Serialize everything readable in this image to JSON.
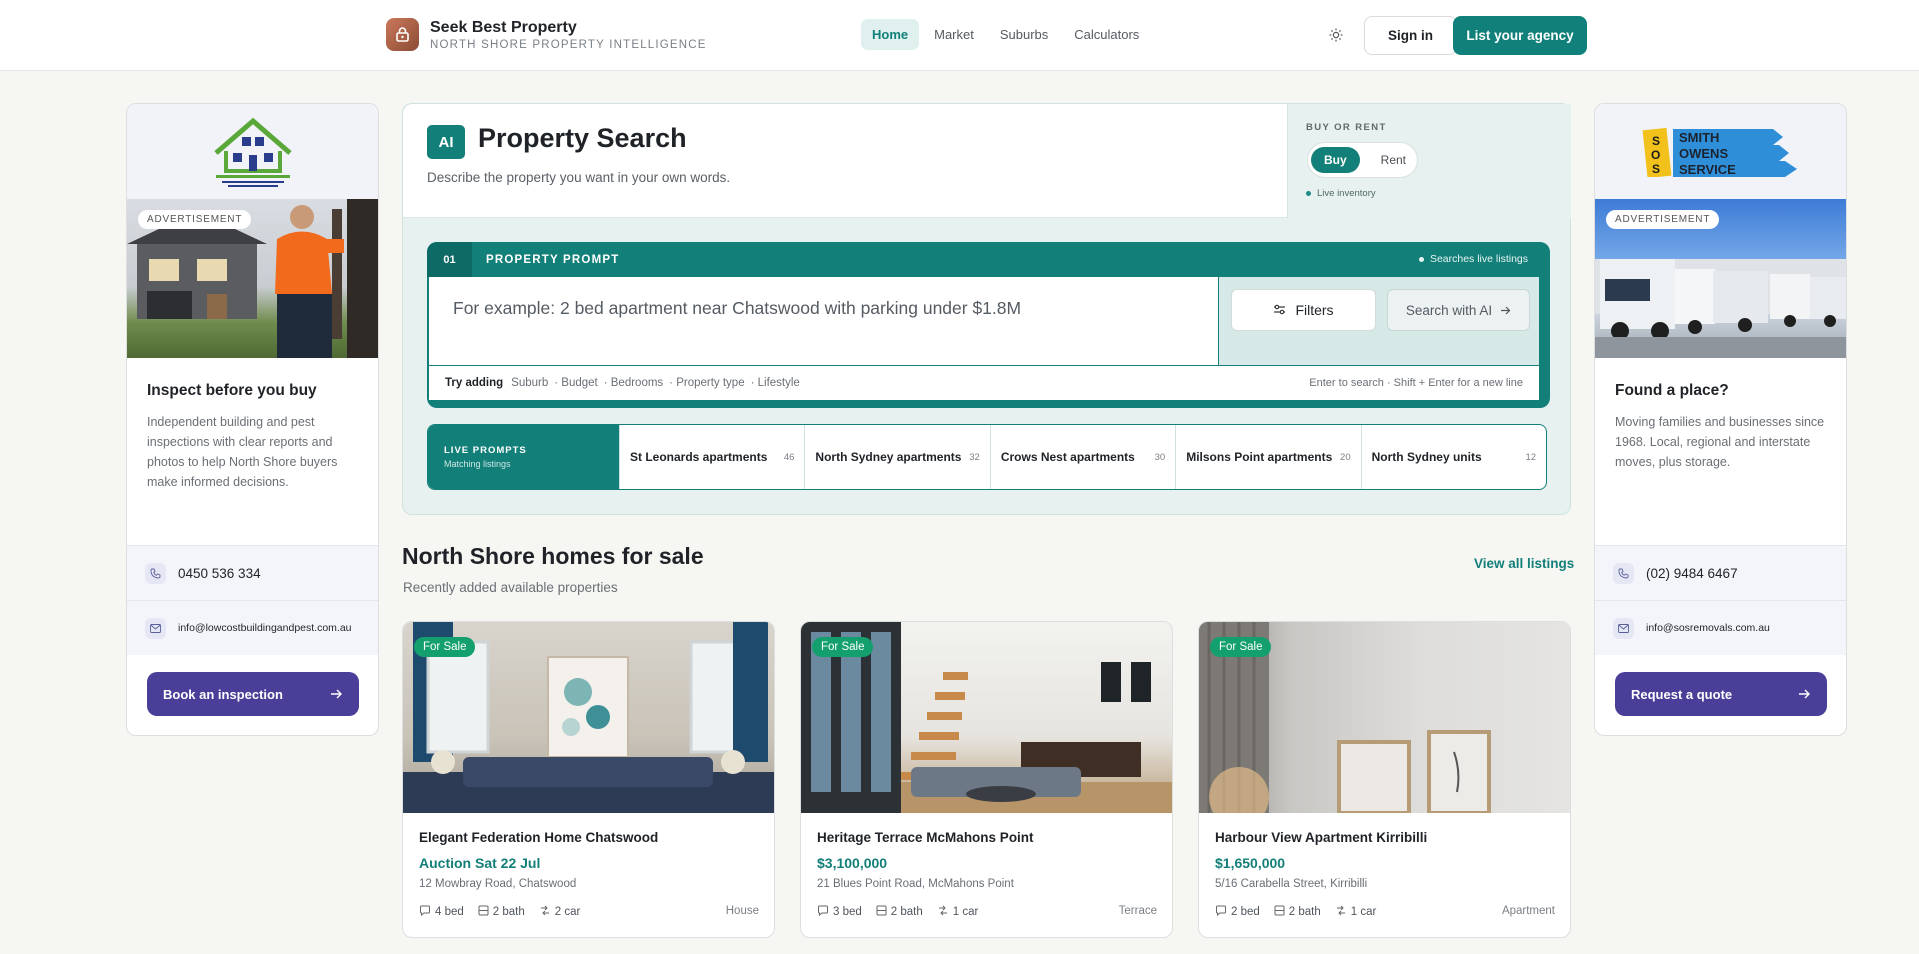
{
  "header": {
    "brand_name": "Seek Best Property",
    "brand_tagline": "NORTH SHORE PROPERTY INTELLIGENCE",
    "nav": [
      "Home",
      "Market",
      "Suburbs",
      "Calculators"
    ],
    "active_nav": "Home",
    "sign_in": "Sign in",
    "list_agency": "List your agency"
  },
  "ad_left": {
    "badge": "ADVERTISEMENT",
    "title": "Inspect before you buy",
    "description": "Independent building and pest inspections with clear reports and photos to help North Shore buyers make informed decisions.",
    "phone": "0450 536 334",
    "email": "info@lowcostbuildingandpest.com.au",
    "cta": "Book an inspection"
  },
  "ad_right": {
    "badge": "ADVERTISEMENT",
    "logo_text": [
      "SMITH",
      "OWENS",
      "SERVICE"
    ],
    "title": "Found a place?",
    "description": "Moving families and businesses since 1968. Local, regional and interstate moves, plus storage.",
    "phone": "(02) 9484 6467",
    "email": "info@sosremovals.com.au",
    "cta": "Request a quote"
  },
  "search": {
    "ai_badge": "AI",
    "title": "Property Search",
    "subtitle": "Describe the property you want in your own words.",
    "mode_label": "BUY OR RENT",
    "modes": [
      "Buy",
      "Rent"
    ],
    "active_mode": "Buy",
    "live_inventory": "Live inventory",
    "step_number": "01",
    "prompt_label": "PROPERTY PROMPT",
    "searches_live": "Searches live listings",
    "placeholder": "For example: 2 bed apartment near Chatswood with parking under $1.8M",
    "filters_label": "Filters",
    "search_ai_label": "Search with AI",
    "try_adding": "Try adding",
    "hints": [
      "Suburb",
      "· Budget",
      "· Bedrooms",
      "· Property type",
      "· Lifestyle"
    ],
    "keys_hint": "Enter to search · Shift + Enter for a new line"
  },
  "live_prompts": {
    "title": "LIVE PROMPTS",
    "subtitle": "Matching listings",
    "items": [
      {
        "label": "St Leonards apartments",
        "count": "46"
      },
      {
        "label": "North Sydney apartments",
        "count": "32"
      },
      {
        "label": "Crows Nest apartments",
        "count": "30"
      },
      {
        "label": "Milsons Point apartments",
        "count": "20"
      },
      {
        "label": "North Sydney units",
        "count": "12"
      }
    ]
  },
  "listings": {
    "title": "North Shore homes for sale",
    "subtitle": "Recently added available properties",
    "view_all": "View all listings",
    "cards": [
      {
        "badge": "For Sale",
        "title": "Elegant Federation Home Chatswood",
        "price": "Auction Sat 22 Jul",
        "address": "12 Mowbray Road, Chatswood",
        "beds": "4 bed",
        "baths": "2 bath",
        "cars": "2 car",
        "type": "House"
      },
      {
        "badge": "For Sale",
        "title": "Heritage Terrace McMahons Point",
        "price": "$3,100,000",
        "address": "21 Blues Point Road, McMahons Point",
        "beds": "3 bed",
        "baths": "2 bath",
        "cars": "1 car",
        "type": "Terrace"
      },
      {
        "badge": "For Sale",
        "title": "Harbour View Apartment Kirribilli",
        "price": "$1,650,000",
        "address": "5/16 Carabella Street, Kirribilli",
        "beds": "2 bed",
        "baths": "2 bath",
        "cars": "1 car",
        "type": "Apartment"
      }
    ]
  },
  "colors": {
    "teal": "#137f79",
    "indigo": "#4a3f98",
    "sale_green": "#14a06e"
  }
}
